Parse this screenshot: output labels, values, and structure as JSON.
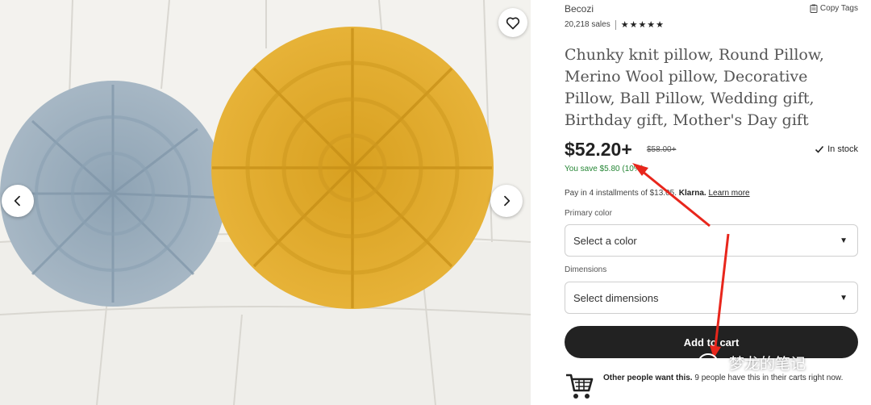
{
  "gallery": {
    "favorite_icon": "heart-outline-icon",
    "prev_icon": "chevron-left-icon",
    "next_icon": "chevron-right-icon",
    "colors": {
      "gray_pillow": "#9fb1c0",
      "gold_pillow": "#e1ab2b",
      "sofa": "#ecebe7"
    }
  },
  "listing": {
    "shop_name": "Becozi",
    "copy_tags_label": "Copy Tags",
    "sales": "20,218 sales",
    "rating_stars": "★★★★★",
    "title": "Chunky knit pillow, Round Pillow, Merino Wool pillow, Decorative Pillow, Ball Pillow, Wedding gift, Birthday gift, Mother's Day gift",
    "price": "$52.20+",
    "original_price": "$58.00+",
    "savings": "You save $5.80 (10%)",
    "stock": "In stock",
    "installments_prefix": "Pay in 4 installments of $13.05.",
    "klarna": "Klarna.",
    "learn_more": "Learn more",
    "primary_color_label": "Primary color",
    "primary_color_value": "Select a color",
    "dimensions_label": "Dimensions",
    "dimensions_value": "Select dimensions",
    "add_to_cart": "Add to cart",
    "demand_bold": "Other people want this.",
    "demand_rest": " 9 people have this in their carts right now."
  },
  "overlay": {
    "watermark_text": "梦龙的笔记",
    "arrow_color": "#e8261c"
  }
}
